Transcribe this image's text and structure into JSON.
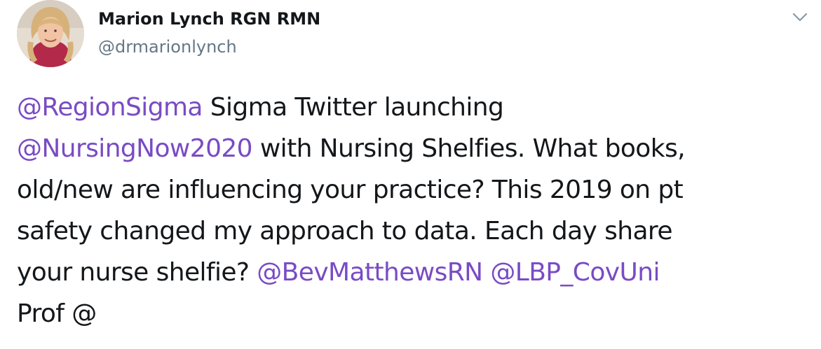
{
  "author": {
    "display_name": "Marion Lynch RGN RMN",
    "handle": "@drmarionlynch",
    "avatar_icon": "profile-photo"
  },
  "menu": {
    "caret_icon": "chevron-down-icon"
  },
  "colors": {
    "text": "#14171a",
    "secondary": "#657786",
    "mention": "#794bc4"
  },
  "tweet": {
    "lines": [
      [
        {
          "type": "mention",
          "text": "@RegionSigma"
        },
        {
          "type": "text",
          "text": " Sigma Twitter launching"
        }
      ],
      [
        {
          "type": "mention",
          "text": "@NursingNow2020"
        },
        {
          "type": "text",
          "text": " with Nursing Shelfies. What books,"
        }
      ],
      [
        {
          "type": "text",
          "text": "old/new are influencing your practice? This 2019 on pt"
        }
      ],
      [
        {
          "type": "text",
          "text": "safety changed my approach to data. Each day share"
        }
      ],
      [
        {
          "type": "text",
          "text": "your nurse shelfie? "
        },
        {
          "type": "mention",
          "text": "@BevMatthewsRN"
        },
        {
          "type": "text",
          "text": " "
        },
        {
          "type": "mention",
          "text": "@LBP_CovUni"
        }
      ],
      [
        {
          "type": "text",
          "text": "Prof @"
        }
      ]
    ]
  }
}
